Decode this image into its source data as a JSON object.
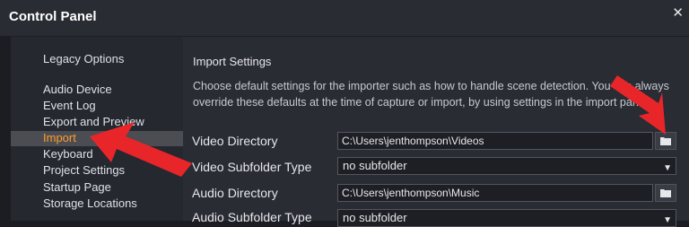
{
  "window": {
    "title": "Control Panel",
    "close_glyph": "✕"
  },
  "sidebar": {
    "items": [
      {
        "label": "Legacy Options"
      },
      {
        "label": "Audio Device"
      },
      {
        "label": "Event Log"
      },
      {
        "label": "Export and Preview"
      },
      {
        "label": "Import",
        "active": true
      },
      {
        "label": "Keyboard"
      },
      {
        "label": "Project Settings"
      },
      {
        "label": "Startup Page"
      },
      {
        "label": "Storage Locations"
      }
    ],
    "active_color": "#ff9c2a"
  },
  "main": {
    "section_title": "Import Settings",
    "description": "Choose default settings for the importer such as how to handle scene detection. You can always override these defaults at the time of capture or import, by using settings in the import panel.",
    "rows": [
      {
        "label": "Video Directory",
        "value": "C:\\Users\\jenthompson\\Videos",
        "type": "directory"
      },
      {
        "label": "Video Subfolder Type",
        "value": "no subfolder",
        "type": "select"
      },
      {
        "label": "Audio Directory",
        "value": "C:\\Users\\jenthompson\\Music",
        "type": "directory"
      },
      {
        "label": "Audio Subfolder Type",
        "value": "no subfolder",
        "type": "select"
      }
    ]
  },
  "annotations": {
    "arrow_color": "#e8262a",
    "icon": "folder-icon"
  }
}
